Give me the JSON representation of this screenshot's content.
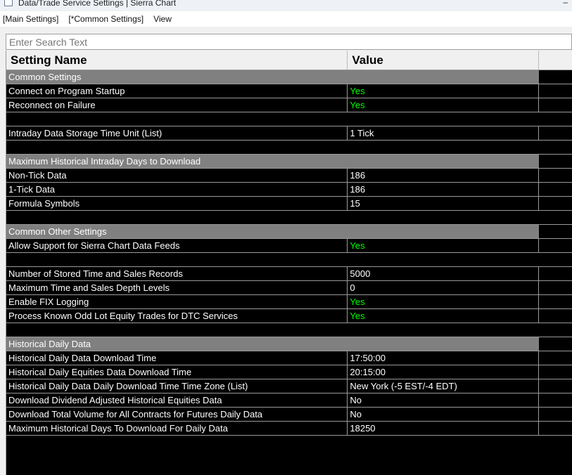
{
  "window": {
    "title": "Data/Trade Service Settings | Sierra Chart",
    "minimize": "–"
  },
  "menu": [
    "[Main Settings]",
    "[*Common Settings]",
    "View"
  ],
  "search": {
    "placeholder": "Enter Search Text"
  },
  "columns": {
    "name": "Setting Name",
    "value": "Value"
  },
  "colors": {
    "yes": "#00ff00",
    "section": "#808080"
  },
  "rows": [
    {
      "type": "section",
      "name": "Common Settings"
    },
    {
      "type": "setting",
      "name": "Connect on Program Startup",
      "value": "Yes"
    },
    {
      "type": "setting",
      "name": "Reconnect on Failure",
      "value": "Yes"
    },
    {
      "type": "blank"
    },
    {
      "type": "setting",
      "name": "Intraday Data Storage Time Unit (List)",
      "value": "1 Tick"
    },
    {
      "type": "blank"
    },
    {
      "type": "section",
      "name": "Maximum Historical Intraday Days to Download"
    },
    {
      "type": "setting",
      "name": "Non-Tick Data",
      "value": "186"
    },
    {
      "type": "setting",
      "name": "1-Tick Data",
      "value": "186"
    },
    {
      "type": "setting",
      "name": "Formula Symbols",
      "value": "15"
    },
    {
      "type": "blank"
    },
    {
      "type": "section",
      "name": "Common Other Settings"
    },
    {
      "type": "setting",
      "name": "Allow Support for Sierra Chart Data Feeds",
      "value": "Yes"
    },
    {
      "type": "blank"
    },
    {
      "type": "setting",
      "name": "Number of Stored Time and Sales Records",
      "value": "5000"
    },
    {
      "type": "setting",
      "name": "Maximum Time and Sales Depth Levels",
      "value": "0"
    },
    {
      "type": "setting",
      "name": "Enable FIX Logging",
      "value": "Yes"
    },
    {
      "type": "setting",
      "name": "Process Known Odd Lot Equity Trades for DTC Services",
      "value": "Yes"
    },
    {
      "type": "blank"
    },
    {
      "type": "section",
      "name": "Historical Daily Data"
    },
    {
      "type": "setting",
      "name": "Historical Daily Data Download Time",
      "value": "17:50:00"
    },
    {
      "type": "setting",
      "name": "Historical Daily Equities Data Download Time",
      "value": "20:15:00"
    },
    {
      "type": "setting",
      "name": "Historical Daily Data Daily Download Time Time Zone (List)",
      "value": "New York (-5 EST/-4 EDT)"
    },
    {
      "type": "setting",
      "name": "Download Dividend Adjusted Historical Equities Data",
      "value": "No"
    },
    {
      "type": "setting",
      "name": "Download Total Volume for All Contracts for Futures Daily Data",
      "value": "No"
    },
    {
      "type": "setting",
      "name": "Maximum Historical Days To Download For Daily Data",
      "value": "18250"
    }
  ]
}
